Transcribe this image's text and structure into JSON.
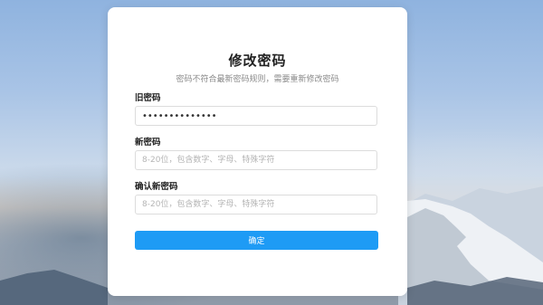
{
  "form": {
    "title": "修改密码",
    "subtitle": "密码不符合最新密码规则，需要重新修改密码",
    "old_password": {
      "label": "旧密码",
      "value": "••••••••••••••"
    },
    "new_password": {
      "label": "新密码",
      "value": "",
      "placeholder": "8-20位，包含数字、字母、特殊字符"
    },
    "confirm_password": {
      "label": "确认新密码",
      "value": "",
      "placeholder": "8-20位，包含数字、字母、特殊字符"
    },
    "submit_label": "确定"
  },
  "colors": {
    "accent": "#1e9bf5",
    "card_bg": "#ffffff"
  }
}
